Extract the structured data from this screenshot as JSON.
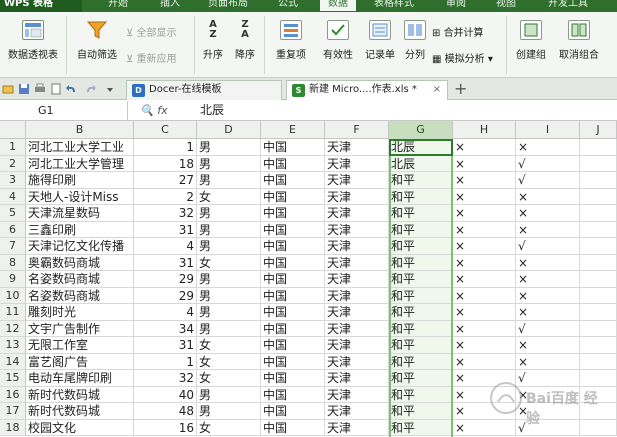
{
  "menubar": {
    "logo": "WPS 表格",
    "items": [
      "开始",
      "插入",
      "页面布局",
      "公式",
      "数据",
      "表格样式",
      "审阅",
      "视图",
      "开发工具"
    ],
    "active_index": 4
  },
  "ribbon": {
    "pivot": "数据透视表",
    "autofilter": "自动筛选",
    "show_all": "全部显示",
    "reapply": "重新应用",
    "sort_asc": "升序",
    "sort_desc": "降序",
    "duplicates": "重复项",
    "validity": "有效性",
    "record": "记录单",
    "split": "分列",
    "consolidate": "合并计算",
    "what_if": "模拟分析",
    "group": "创建组",
    "ungroup": "取消组合"
  },
  "tabs": {
    "docer": "Docer-在线模板",
    "workbook": "新建 Micro....作表.xls *"
  },
  "formula_bar": {
    "cell_ref": "G1",
    "fx_label": "fx",
    "value": "北辰"
  },
  "columns": [
    "B",
    "C",
    "D",
    "E",
    "F",
    "G",
    "H",
    "I",
    "J"
  ],
  "rows": [
    {
      "n": "1",
      "b": "河北工业大学工业",
      "c": "1",
      "d": "男",
      "e": "中国",
      "f": "天津",
      "g": "北辰",
      "h": "×",
      "i": "×"
    },
    {
      "n": "2",
      "b": "河北工业大学管理",
      "c": "18",
      "d": "男",
      "e": "中国",
      "f": "天津",
      "g": "北辰",
      "h": "×",
      "i": "√"
    },
    {
      "n": "3",
      "b": "施得印刷",
      "c": "27",
      "d": "男",
      "e": "中国",
      "f": "天津",
      "g": "和平",
      "h": "×",
      "i": "√"
    },
    {
      "n": "4",
      "b": "天地人-设计Miss",
      "c": "2",
      "d": "女",
      "e": "中国",
      "f": "天津",
      "g": "和平",
      "h": "×",
      "i": "×"
    },
    {
      "n": "5",
      "b": "天津流星数码",
      "c": "32",
      "d": "男",
      "e": "中国",
      "f": "天津",
      "g": "和平",
      "h": "×",
      "i": "×"
    },
    {
      "n": "6",
      "b": "三鑫印刷",
      "c": "31",
      "d": "男",
      "e": "中国",
      "f": "天津",
      "g": "和平",
      "h": "×",
      "i": "×"
    },
    {
      "n": "7",
      "b": "天津记忆文化传播",
      "c": "4",
      "d": "男",
      "e": "中国",
      "f": "天津",
      "g": "和平",
      "h": "×",
      "i": "√"
    },
    {
      "n": "8",
      "b": "奥霸数码商城",
      "c": "31",
      "d": "女",
      "e": "中国",
      "f": "天津",
      "g": "和平",
      "h": "×",
      "i": "×"
    },
    {
      "n": "9",
      "b": "名姿数码商城",
      "c": "29",
      "d": "男",
      "e": "中国",
      "f": "天津",
      "g": "和平",
      "h": "×",
      "i": "×"
    },
    {
      "n": "10",
      "b": "名姿数码商城",
      "c": "29",
      "d": "男",
      "e": "中国",
      "f": "天津",
      "g": "和平",
      "h": "×",
      "i": "×"
    },
    {
      "n": "11",
      "b": "雕刻时光",
      "c": "4",
      "d": "男",
      "e": "中国",
      "f": "天津",
      "g": "和平",
      "h": "×",
      "i": "×"
    },
    {
      "n": "12",
      "b": "文宇广告制作",
      "c": "34",
      "d": "男",
      "e": "中国",
      "f": "天津",
      "g": "和平",
      "h": "×",
      "i": "√"
    },
    {
      "n": "13",
      "b": "无限工作室",
      "c": "31",
      "d": "女",
      "e": "中国",
      "f": "天津",
      "g": "和平",
      "h": "×",
      "i": "×"
    },
    {
      "n": "14",
      "b": "富艺阁广告",
      "c": "1",
      "d": "女",
      "e": "中国",
      "f": "天津",
      "g": "和平",
      "h": "×",
      "i": "×"
    },
    {
      "n": "15",
      "b": "电动车尾牌印刷",
      "c": "32",
      "d": "女",
      "e": "中国",
      "f": "天津",
      "g": "和平",
      "h": "×",
      "i": "√"
    },
    {
      "n": "16",
      "b": "新时代数码城",
      "c": "40",
      "d": "男",
      "e": "中国",
      "f": "天津",
      "g": "和平",
      "h": "×",
      "i": "×"
    },
    {
      "n": "17",
      "b": "新时代数码城",
      "c": "48",
      "d": "男",
      "e": "中国",
      "f": "天津",
      "g": "和平",
      "h": "×",
      "i": "×"
    },
    {
      "n": "18",
      "b": "校园文化",
      "c": "16",
      "d": "女",
      "e": "中国",
      "f": "天津",
      "g": "和平",
      "h": "×",
      "i": "√"
    }
  ],
  "watermark": "Bai百度 经验",
  "colors": {
    "menubar": "#2f6e2d",
    "ribbon": "#f3f6f2",
    "selection": "#2e7a2e",
    "selected_col_fill": "#f0f8ee"
  }
}
